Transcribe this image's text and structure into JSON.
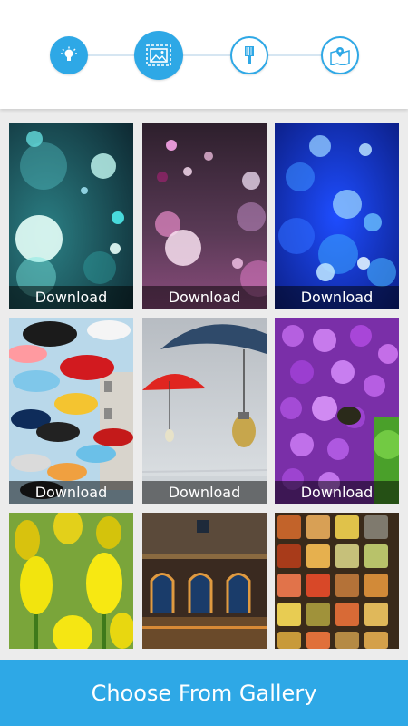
{
  "stepper": {
    "steps": [
      {
        "icon": "lightbulb-icon",
        "state": "done"
      },
      {
        "icon": "image-frame-icon",
        "state": "active"
      },
      {
        "icon": "brush-icon",
        "state": "pending"
      },
      {
        "icon": "map-pin-icon",
        "state": "pending"
      }
    ]
  },
  "gallery": {
    "tiles": [
      {
        "subject": "teal bokeh",
        "download_label": "Download"
      },
      {
        "subject": "pink bokeh",
        "download_label": "Download"
      },
      {
        "subject": "blue bokeh",
        "download_label": "Download"
      },
      {
        "subject": "umbrellas sky",
        "download_label": "Download"
      },
      {
        "subject": "umbrella bulbs",
        "download_label": "Download"
      },
      {
        "subject": "lilac flowers",
        "download_label": "Download"
      },
      {
        "subject": "yellow tulips"
      },
      {
        "subject": "colosseum"
      },
      {
        "subject": "colored squares"
      }
    ]
  },
  "footer": {
    "choose_label": "Choose From Gallery"
  },
  "colors": {
    "accent": "#2ea8e6",
    "background": "#ececec"
  }
}
